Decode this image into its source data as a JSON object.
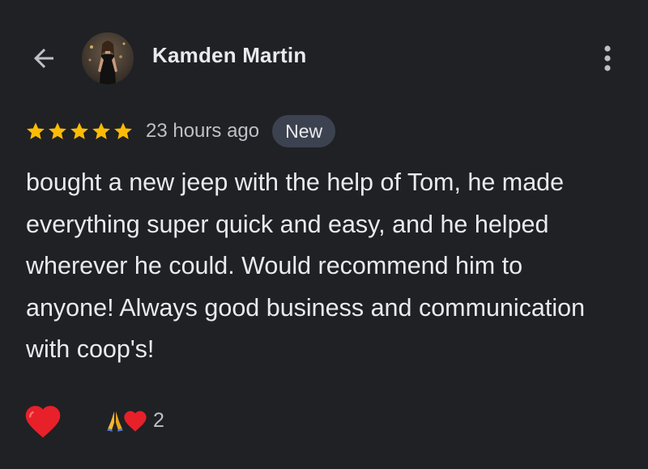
{
  "reviewer": {
    "name": "Kamden Martin"
  },
  "review": {
    "rating": 5,
    "max_rating": 5,
    "time_ago": "23 hours ago",
    "badge": "New",
    "text": "bought a new jeep with the help of Tom, he made everything super quick and easy, and he helped wherever he could. Would recommend him to anyone! Always good business and communication with coop's!"
  },
  "reactions": {
    "count": "2",
    "types": [
      "folded-hands",
      "red-heart"
    ]
  },
  "icons": {
    "back": "arrow-left-icon",
    "more": "more-vertical-icon",
    "star": "star-icon",
    "like": "red-heart-icon"
  },
  "colors": {
    "background": "#202124",
    "text_primary": "#e8eaed",
    "text_secondary": "#bdc1c6",
    "star": "#fbbc04",
    "badge_bg": "#3c4250",
    "heart": "#e8202a"
  }
}
